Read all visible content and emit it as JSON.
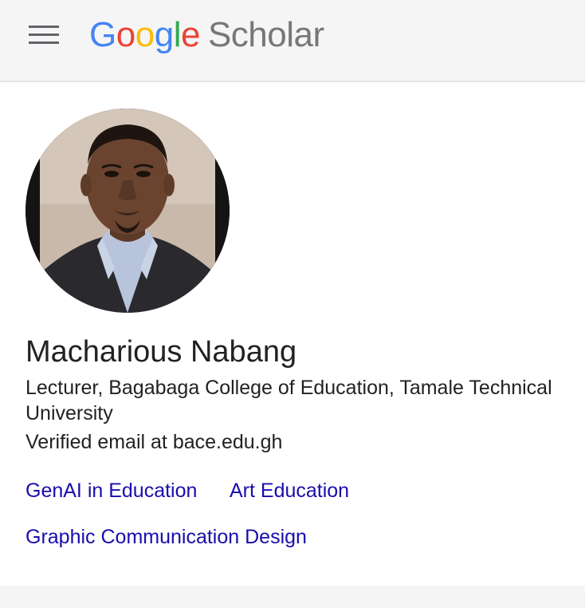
{
  "header": {
    "menu_icon": "hamburger-menu-icon",
    "logo": {
      "letters": [
        "G",
        "o",
        "o",
        "g",
        "l",
        "e"
      ],
      "product": "Scholar"
    }
  },
  "profile": {
    "avatar": "profile-photo",
    "name": "Macharious Nabang",
    "affiliation": "Lecturer, Bagabaga College of Education, Tamale Technical University",
    "email": "Verified email at bace.edu.gh",
    "interests": [
      "GenAI in Education",
      "Art Education",
      "Graphic Communication Design"
    ]
  },
  "colors": {
    "link": "#1a0dab",
    "header_bg": "#f5f5f5",
    "text": "#222222"
  }
}
